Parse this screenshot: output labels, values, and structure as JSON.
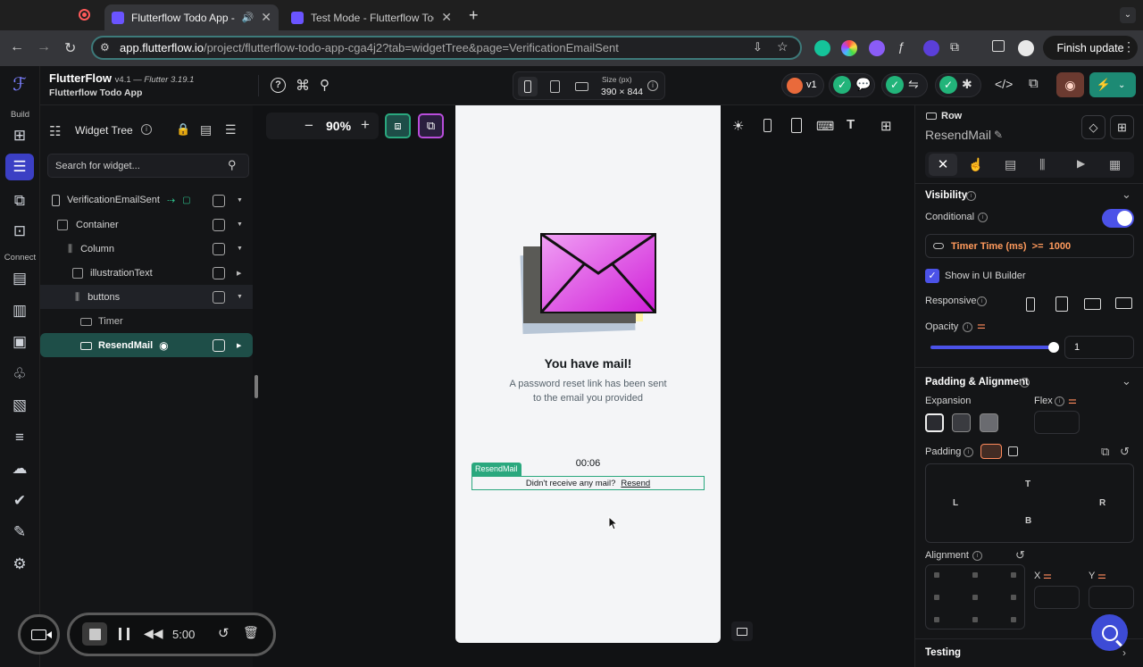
{
  "browser": {
    "tabs": [
      {
        "title": "Flutterflow Todo App - Flu",
        "active": true
      },
      {
        "title": "Test Mode - Flutterflow Todo",
        "active": false
      }
    ],
    "url_host": "app.flutterflow.io",
    "url_path": "/project/flutterflow-todo-app-cga4j2?tab=widgetTree&page=VerificationEmailSent",
    "finish_update_label": "Finish update"
  },
  "header": {
    "brand": "FlutterFlow",
    "version": "v4.1 —",
    "flutter_version": "Flutter 3.19.1",
    "project_name": "Flutterflow Todo App",
    "size_label": "Size (px)",
    "size_value": "390 × 844",
    "version_pill": "v1"
  },
  "rail": {
    "build_label": "Build",
    "connect_label": "Connect"
  },
  "tree": {
    "title": "Widget Tree",
    "search_placeholder": "Search for widget...",
    "nodes": [
      {
        "label": "VerificationEmailSent"
      },
      {
        "label": "Container"
      },
      {
        "label": "Column"
      },
      {
        "label": "illustrationText"
      },
      {
        "label": "buttons"
      },
      {
        "label": "Timer"
      },
      {
        "label": "ResendMail"
      }
    ]
  },
  "canvas": {
    "zoom": "90%",
    "mail_title": "You have mail!",
    "mail_body_1": "A password reset link has been sent",
    "mail_body_2": "to the email you provided",
    "timer_text": "00:06",
    "selected_tag": "ResendMail",
    "resend_prompt": "Didn't receive any mail?",
    "resend_link": "Resend"
  },
  "properties": {
    "widget_type": "Row",
    "widget_name": "ResendMail",
    "visibility_title": "Visibility",
    "conditional_label": "Conditional",
    "conditional_on": true,
    "condition_text": "Timer Time (ms)  >=  1000",
    "show_in_builder_label": "Show in UI Builder",
    "show_in_builder_checked": true,
    "responsive_label": "Responsive",
    "opacity_label": "Opacity",
    "opacity_value": "1",
    "padding_alignment_title": "Padding & Alignment",
    "expansion_label": "Expansion",
    "flex_label": "Flex",
    "padding_label": "Padding",
    "pad_t": "T",
    "pad_l": "L",
    "pad_r": "R",
    "pad_b": "B",
    "alignment_label": "Alignment",
    "x_label": "X",
    "y_label": "Y",
    "testing_label": "Testing"
  },
  "recorder": {
    "time": "5:00"
  },
  "colors": {
    "accent_indigo": "#4b52e8",
    "brand_teal": "#1e4e48",
    "selection_green": "#2aa87e"
  }
}
